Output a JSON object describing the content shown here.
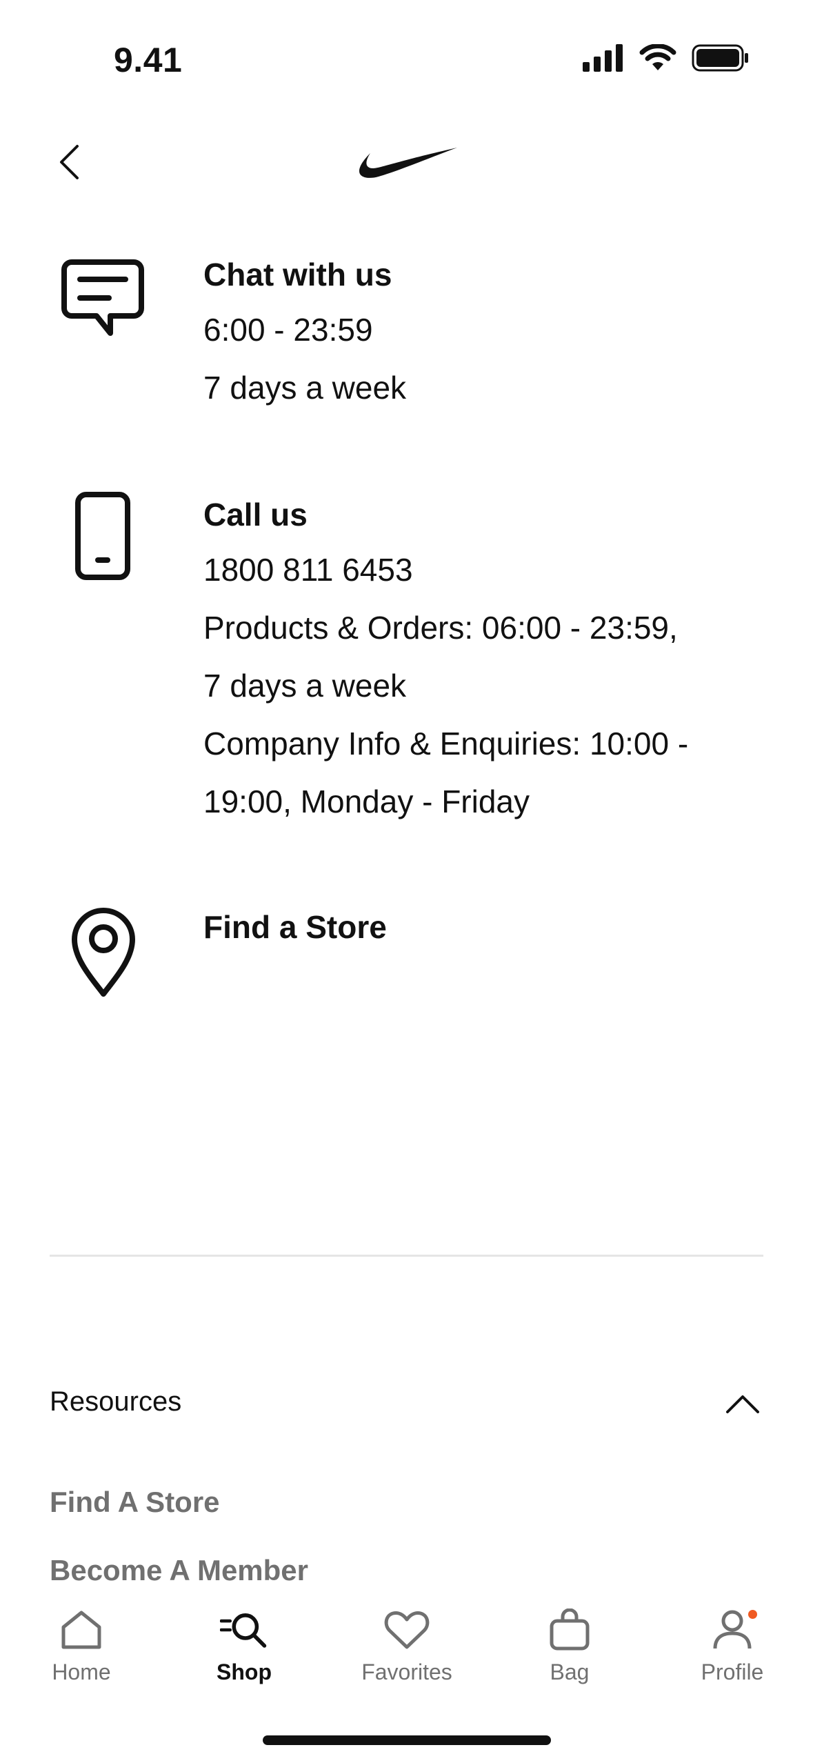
{
  "status_bar": {
    "time": "9.41"
  },
  "contact": {
    "chat": {
      "title": "Chat with us",
      "lines": [
        "6:00 - 23:59",
        "7 days a week"
      ]
    },
    "call": {
      "title": "Call us",
      "lines": [
        "1800 811 6453",
        "Products & Orders: 06:00 - 23:59,",
        "7 days a week",
        "Company Info & Enquiries: 10:00 -",
        "19:00, Monday - Friday"
      ]
    },
    "store": {
      "title": "Find a Store"
    }
  },
  "resources": {
    "title": "Resources",
    "links": [
      "Find A Store",
      "Become A Member"
    ]
  },
  "tab_bar": {
    "items": [
      {
        "label": "Home",
        "icon": "home-icon"
      },
      {
        "label": "Shop",
        "icon": "shop-search-icon"
      },
      {
        "label": "Favorites",
        "icon": "heart-icon"
      },
      {
        "label": "Bag",
        "icon": "bag-icon"
      },
      {
        "label": "Profile",
        "icon": "person-icon"
      }
    ],
    "active": "Shop"
  },
  "colors": {
    "text": "#111111",
    "muted": "#707070",
    "divider": "#e5e5e5",
    "notification_dot": "#f05a22"
  }
}
